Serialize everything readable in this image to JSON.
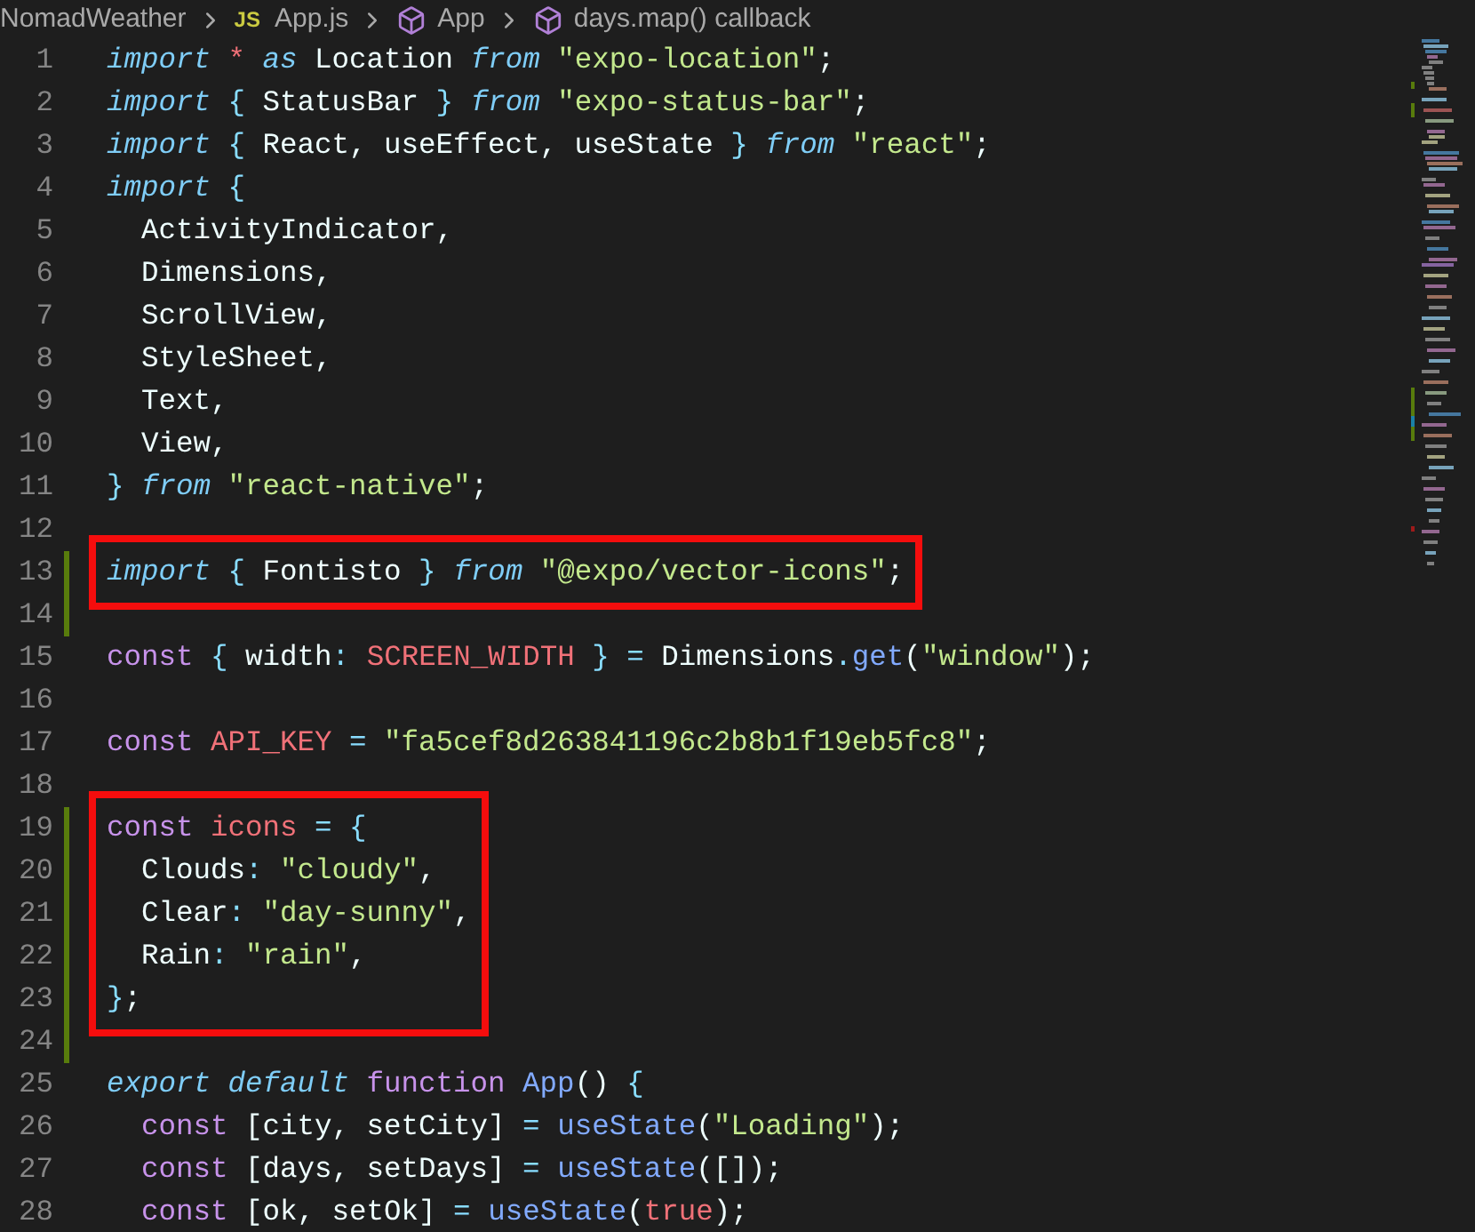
{
  "breadcrumb": [
    {
      "kind": "folder",
      "label": "NomadWeather"
    },
    {
      "kind": "file",
      "icon_text": "JS",
      "label": "App.js"
    },
    {
      "kind": "symbol",
      "label": "App"
    },
    {
      "kind": "symbol",
      "label": "days.map() callback"
    }
  ],
  "blocks": [
    {
      "highlighted": false,
      "lines": [
        {
          "number": "1",
          "changed": false,
          "tokens": [
            {
              "kind": "kw",
              "text": "import"
            },
            {
              "kind": "const",
              "text": " *"
            },
            {
              "kind": "kw",
              "text": " as"
            },
            {
              "kind": "plain",
              "text": " Location"
            },
            {
              "kind": "kw",
              "text": " from"
            },
            {
              "kind": "str",
              "text": " \"expo-location\""
            },
            {
              "kind": "plain",
              "text": ";"
            }
          ]
        },
        {
          "number": "2",
          "changed": false,
          "tokens": [
            {
              "kind": "kw",
              "text": "import"
            },
            {
              "kind": "punct",
              "text": " { "
            },
            {
              "kind": "plain",
              "text": "StatusBar"
            },
            {
              "kind": "punct",
              "text": " } "
            },
            {
              "kind": "kw",
              "text": "from"
            },
            {
              "kind": "str",
              "text": " \"expo-status-bar\""
            },
            {
              "kind": "plain",
              "text": ";"
            }
          ]
        },
        {
          "number": "3",
          "changed": false,
          "tokens": [
            {
              "kind": "kw",
              "text": "import"
            },
            {
              "kind": "punct",
              "text": " { "
            },
            {
              "kind": "plain",
              "text": "React, useEffect, useState"
            },
            {
              "kind": "punct",
              "text": " } "
            },
            {
              "kind": "kw",
              "text": "from"
            },
            {
              "kind": "str",
              "text": " \"react\""
            },
            {
              "kind": "plain",
              "text": ";"
            }
          ]
        },
        {
          "number": "4",
          "changed": false,
          "tokens": [
            {
              "kind": "kw",
              "text": "import"
            },
            {
              "kind": "punct",
              "text": " {"
            }
          ]
        },
        {
          "number": "5",
          "changed": false,
          "tokens": [
            {
              "kind": "plain",
              "text": "  ActivityIndicator,"
            }
          ]
        },
        {
          "number": "6",
          "changed": false,
          "tokens": [
            {
              "kind": "plain",
              "text": "  Dimensions,"
            }
          ]
        },
        {
          "number": "7",
          "changed": false,
          "tokens": [
            {
              "kind": "plain",
              "text": "  ScrollView,"
            }
          ]
        },
        {
          "number": "8",
          "changed": false,
          "tokens": [
            {
              "kind": "plain",
              "text": "  StyleSheet,"
            }
          ]
        },
        {
          "number": "9",
          "changed": false,
          "tokens": [
            {
              "kind": "plain",
              "text": "  Text,"
            }
          ]
        },
        {
          "number": "10",
          "changed": false,
          "tokens": [
            {
              "kind": "plain",
              "text": "  View,"
            }
          ]
        },
        {
          "number": "11",
          "changed": false,
          "tokens": [
            {
              "kind": "punct",
              "text": "} "
            },
            {
              "kind": "kw",
              "text": "from"
            },
            {
              "kind": "str",
              "text": " \"react-native\""
            },
            {
              "kind": "plain",
              "text": ";"
            }
          ]
        },
        {
          "number": "12",
          "changed": false
        }
      ]
    },
    {
      "highlighted": true,
      "lines": [
        {
          "number": "13",
          "changed": true,
          "tokens": [
            {
              "kind": "kw",
              "text": "import"
            },
            {
              "kind": "punct",
              "text": " { "
            },
            {
              "kind": "plain",
              "text": "Fontisto"
            },
            {
              "kind": "punct",
              "text": " } "
            },
            {
              "kind": "kw",
              "text": "from"
            },
            {
              "kind": "str",
              "text": " \"@expo/vector-icons\""
            },
            {
              "kind": "plain",
              "text": ";"
            }
          ]
        }
      ]
    },
    {
      "highlighted": false,
      "lines": [
        {
          "number": "14",
          "changed": true
        },
        {
          "number": "15",
          "changed": false,
          "tokens": [
            {
              "kind": "decl",
              "text": "const"
            },
            {
              "kind": "punct",
              "text": " { "
            },
            {
              "kind": "plain",
              "text": "width"
            },
            {
              "kind": "punct",
              "text": ": "
            },
            {
              "kind": "const",
              "text": "SCREEN_WIDTH"
            },
            {
              "kind": "punct",
              "text": " } = "
            },
            {
              "kind": "plain",
              "text": "Dimensions"
            },
            {
              "kind": "punct",
              "text": "."
            },
            {
              "kind": "fn",
              "text": "get"
            },
            {
              "kind": "plain",
              "text": "("
            },
            {
              "kind": "str",
              "text": "\"window\""
            },
            {
              "kind": "plain",
              "text": ");"
            }
          ]
        },
        {
          "number": "16",
          "changed": false
        },
        {
          "number": "17",
          "changed": false,
          "tokens": [
            {
              "kind": "decl",
              "text": "const"
            },
            {
              "kind": "const",
              "text": " API_KEY"
            },
            {
              "kind": "punct",
              "text": " = "
            },
            {
              "kind": "str",
              "text": "\"fa5cef8d263841196c2b8b1f19eb5fc8\""
            },
            {
              "kind": "plain",
              "text": ";"
            }
          ]
        },
        {
          "number": "18",
          "changed": false
        }
      ]
    },
    {
      "highlighted": true,
      "lines": [
        {
          "number": "19",
          "changed": true,
          "tokens": [
            {
              "kind": "decl",
              "text": "const"
            },
            {
              "kind": "const",
              "text": " icons"
            },
            {
              "kind": "punct",
              "text": " = {"
            }
          ]
        },
        {
          "number": "20",
          "changed": true,
          "tokens": [
            {
              "kind": "plain",
              "text": "  Clouds"
            },
            {
              "kind": "punct",
              "text": ": "
            },
            {
              "kind": "str",
              "text": "\"cloudy\""
            },
            {
              "kind": "plain",
              "text": ","
            }
          ]
        },
        {
          "number": "21",
          "changed": true,
          "tokens": [
            {
              "kind": "plain",
              "text": "  Clear"
            },
            {
              "kind": "punct",
              "text": ": "
            },
            {
              "kind": "str",
              "text": "\"day-sunny\""
            },
            {
              "kind": "plain",
              "text": ","
            }
          ]
        },
        {
          "number": "22",
          "changed": true,
          "tokens": [
            {
              "kind": "plain",
              "text": "  Rain"
            },
            {
              "kind": "punct",
              "text": ": "
            },
            {
              "kind": "str",
              "text": "\"rain\""
            },
            {
              "kind": "plain",
              "text": ","
            }
          ]
        },
        {
          "number": "23",
          "changed": true,
          "tokens": [
            {
              "kind": "punct",
              "text": "}"
            },
            {
              "kind": "plain",
              "text": ";"
            }
          ]
        }
      ]
    },
    {
      "highlighted": false,
      "lines": [
        {
          "number": "24",
          "changed": true
        },
        {
          "number": "25",
          "changed": false,
          "tokens": [
            {
              "kind": "kw",
              "text": "export"
            },
            {
              "kind": "kw",
              "text": " default"
            },
            {
              "kind": "decl",
              "text": " function"
            },
            {
              "kind": "fn",
              "text": " App"
            },
            {
              "kind": "plain",
              "text": "() "
            },
            {
              "kind": "punct",
              "text": "{"
            }
          ]
        },
        {
          "number": "26",
          "changed": false,
          "tokens": [
            {
              "kind": "decl",
              "text": "  const"
            },
            {
              "kind": "plain",
              "text": " [city, setCity] "
            },
            {
              "kind": "punct",
              "text": "="
            },
            {
              "kind": "fn",
              "text": " useState"
            },
            {
              "kind": "plain",
              "text": "("
            },
            {
              "kind": "str",
              "text": "\"Loading\""
            },
            {
              "kind": "plain",
              "text": ");"
            }
          ]
        },
        {
          "number": "27",
          "changed": false,
          "tokens": [
            {
              "kind": "decl",
              "text": "  const"
            },
            {
              "kind": "plain",
              "text": " [days, setDays] "
            },
            {
              "kind": "punct",
              "text": "="
            },
            {
              "kind": "fn",
              "text": " useState"
            },
            {
              "kind": "plain",
              "text": "([]);"
            }
          ]
        },
        {
          "number": "28",
          "changed": false,
          "tokens": [
            {
              "kind": "decl",
              "text": "  const"
            },
            {
              "kind": "plain",
              "text": " [ok, setOk] "
            },
            {
              "kind": "punct",
              "text": "="
            },
            {
              "kind": "fn",
              "text": " useState"
            },
            {
              "kind": "plain",
              "text": "("
            },
            {
              "kind": "const",
              "text": "true"
            },
            {
              "kind": "plain",
              "text": ");"
            }
          ]
        }
      ]
    }
  ]
}
